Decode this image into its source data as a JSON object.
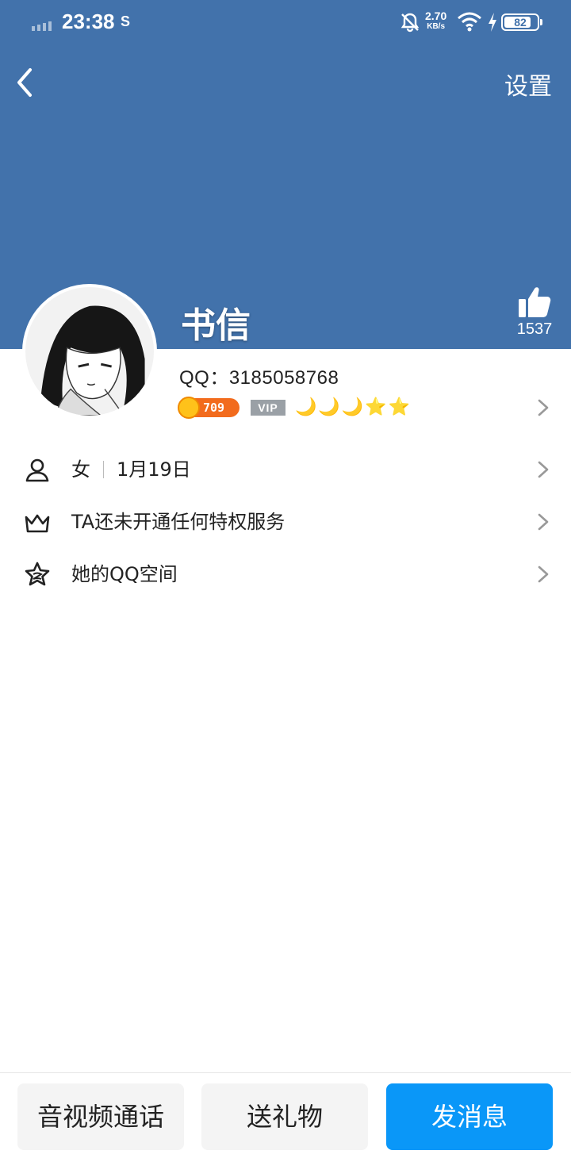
{
  "status_bar": {
    "time": "23:38",
    "sim_icon": "S",
    "net_speed_value": "2.70",
    "net_speed_unit": "KB/s",
    "battery_percent": "82",
    "battery_level": 0.82,
    "icons": [
      "signal-icon",
      "notifications-muted-icon",
      "wifi-icon",
      "charging-icon",
      "battery-icon"
    ]
  },
  "header": {
    "back_icon": "back-icon",
    "settings_label": "设置",
    "banner_color": "#4272ab"
  },
  "profile": {
    "name": "书信",
    "likes": "1537",
    "qq_line": "QQ：3185058768",
    "coin_level": "709",
    "vip_label": "VIP",
    "level_icons": [
      "moon",
      "moon",
      "moon",
      "star",
      "star"
    ],
    "level_glyphs": [
      "🌙",
      "🌙",
      "🌙",
      "⭐",
      "⭐"
    ]
  },
  "info_rows": [
    {
      "icon": "person-icon",
      "gender": "女",
      "birthday": "1月19日"
    },
    {
      "icon": "crown-icon",
      "label": "TA还未开通任何特权服务"
    },
    {
      "icon": "star-icon",
      "label": "她的QQ空间"
    }
  ],
  "actions": {
    "call_label": "音视频通话",
    "gift_label": "送礼物",
    "message_label": "发消息",
    "primary_color": "#0a97f8"
  }
}
